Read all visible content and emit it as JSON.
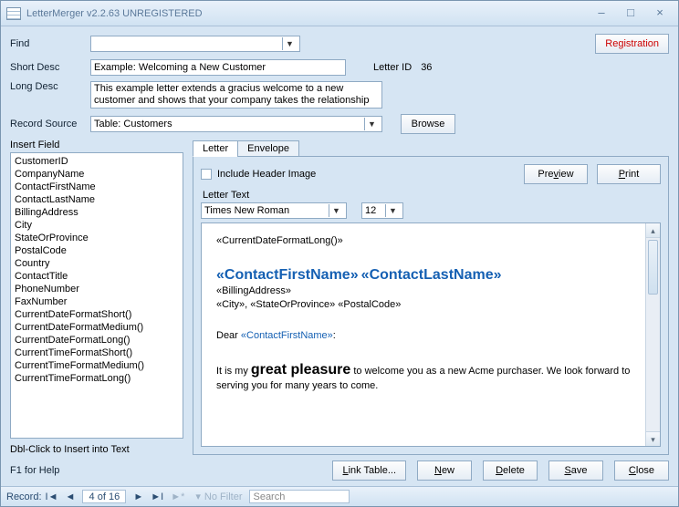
{
  "window": {
    "title": "LetterMerger v2.2.63 UNREGISTERED"
  },
  "header": {
    "find_label": "Find",
    "shortdesc_label": "Short Desc",
    "shortdesc_value": "Example: Welcoming a New Customer",
    "letterid_label": "Letter ID",
    "letterid_value": "36",
    "longdesc_label": "Long Desc",
    "longdesc_value": "This example letter extends a gracius welcome to a new customer and shows that your company takes the relationship",
    "recordsource_label": "Record Source",
    "recordsource_value": "Table: Customers",
    "browse": "Browse",
    "registration": "Registration"
  },
  "left": {
    "insert_label": "Insert Field",
    "fields": [
      "CustomerID",
      "CompanyName",
      "ContactFirstName",
      "ContactLastName",
      "BillingAddress",
      "City",
      "StateOrProvince",
      "PostalCode",
      "Country",
      "ContactTitle",
      "PhoneNumber",
      "FaxNumber",
      "CurrentDateFormatShort()",
      "CurrentDateFormatMedium()",
      "CurrentDateFormatLong()",
      "CurrentTimeFormatShort()",
      "CurrentTimeFormatMedium()",
      "CurrentTimeFormatLong()"
    ],
    "hint": "Dbl-Click to Insert into Text"
  },
  "tabs": {
    "letter": "Letter",
    "envelope": "Envelope"
  },
  "letterpage": {
    "include_header": "Include Header Image",
    "lettertext_label": "Letter Text",
    "font": "Times New Roman",
    "size": "12",
    "preview": "Preview",
    "print": "Print"
  },
  "body": {
    "date_field": "«CurrentDateFormatLong()»",
    "name1": "«ContactFirstName»",
    "name2": "«ContactLastName»",
    "billing": "«BillingAddress»",
    "csz": "«City», «StateOrProvince» «PostalCode»",
    "dear": "Dear ",
    "dear_field": "«ContactFirstName»",
    "p_a": "It is my ",
    "p_b": "great pleasure",
    "p_c": " to welcome you as a new Acme purchaser.  We look forward to serving you for many years to come."
  },
  "footer": {
    "help": "F1 for Help",
    "link_table": "Link Table...",
    "new": "New",
    "delete": "Delete",
    "save": "Save",
    "close": "Close"
  },
  "nav": {
    "record_label": "Record:",
    "position": "4 of 16",
    "nofilter": "No Filter",
    "search": "Search"
  }
}
